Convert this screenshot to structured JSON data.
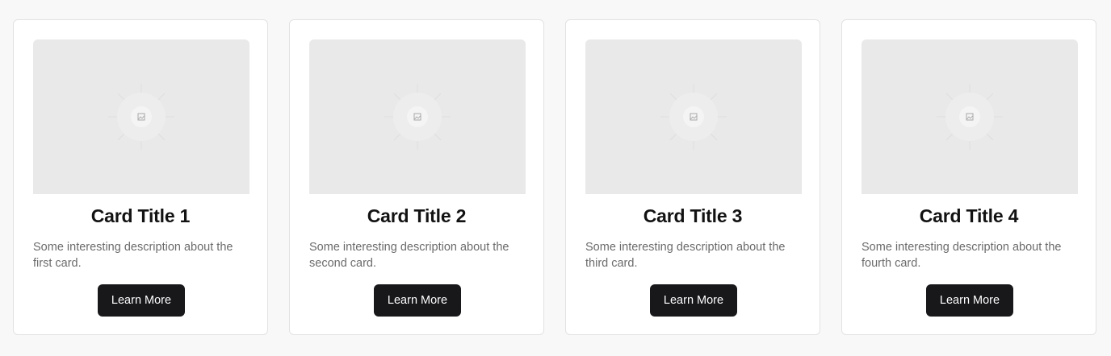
{
  "cards": [
    {
      "title": "Card Title 1",
      "description": "Some interesting description about the first card.",
      "button_label": "Learn More",
      "image_icon": "image-placeholder-icon"
    },
    {
      "title": "Card Title 2",
      "description": "Some interesting description about the second card.",
      "button_label": "Learn More",
      "image_icon": "image-placeholder-icon"
    },
    {
      "title": "Card Title 3",
      "description": "Some interesting description about the third card.",
      "button_label": "Learn More",
      "image_icon": "image-placeholder-icon"
    },
    {
      "title": "Card Title 4",
      "description": "Some interesting description about the fourth card.",
      "button_label": "Learn More",
      "image_icon": "image-placeholder-icon"
    }
  ],
  "colors": {
    "page_background": "#f8f8f8",
    "card_background": "#ffffff",
    "card_border": "#e2e2e2",
    "image_background": "#e9e9e9",
    "button_background": "#18181b",
    "button_text": "#ffffff",
    "title_text": "#121212",
    "description_text": "#6b6b6b"
  }
}
